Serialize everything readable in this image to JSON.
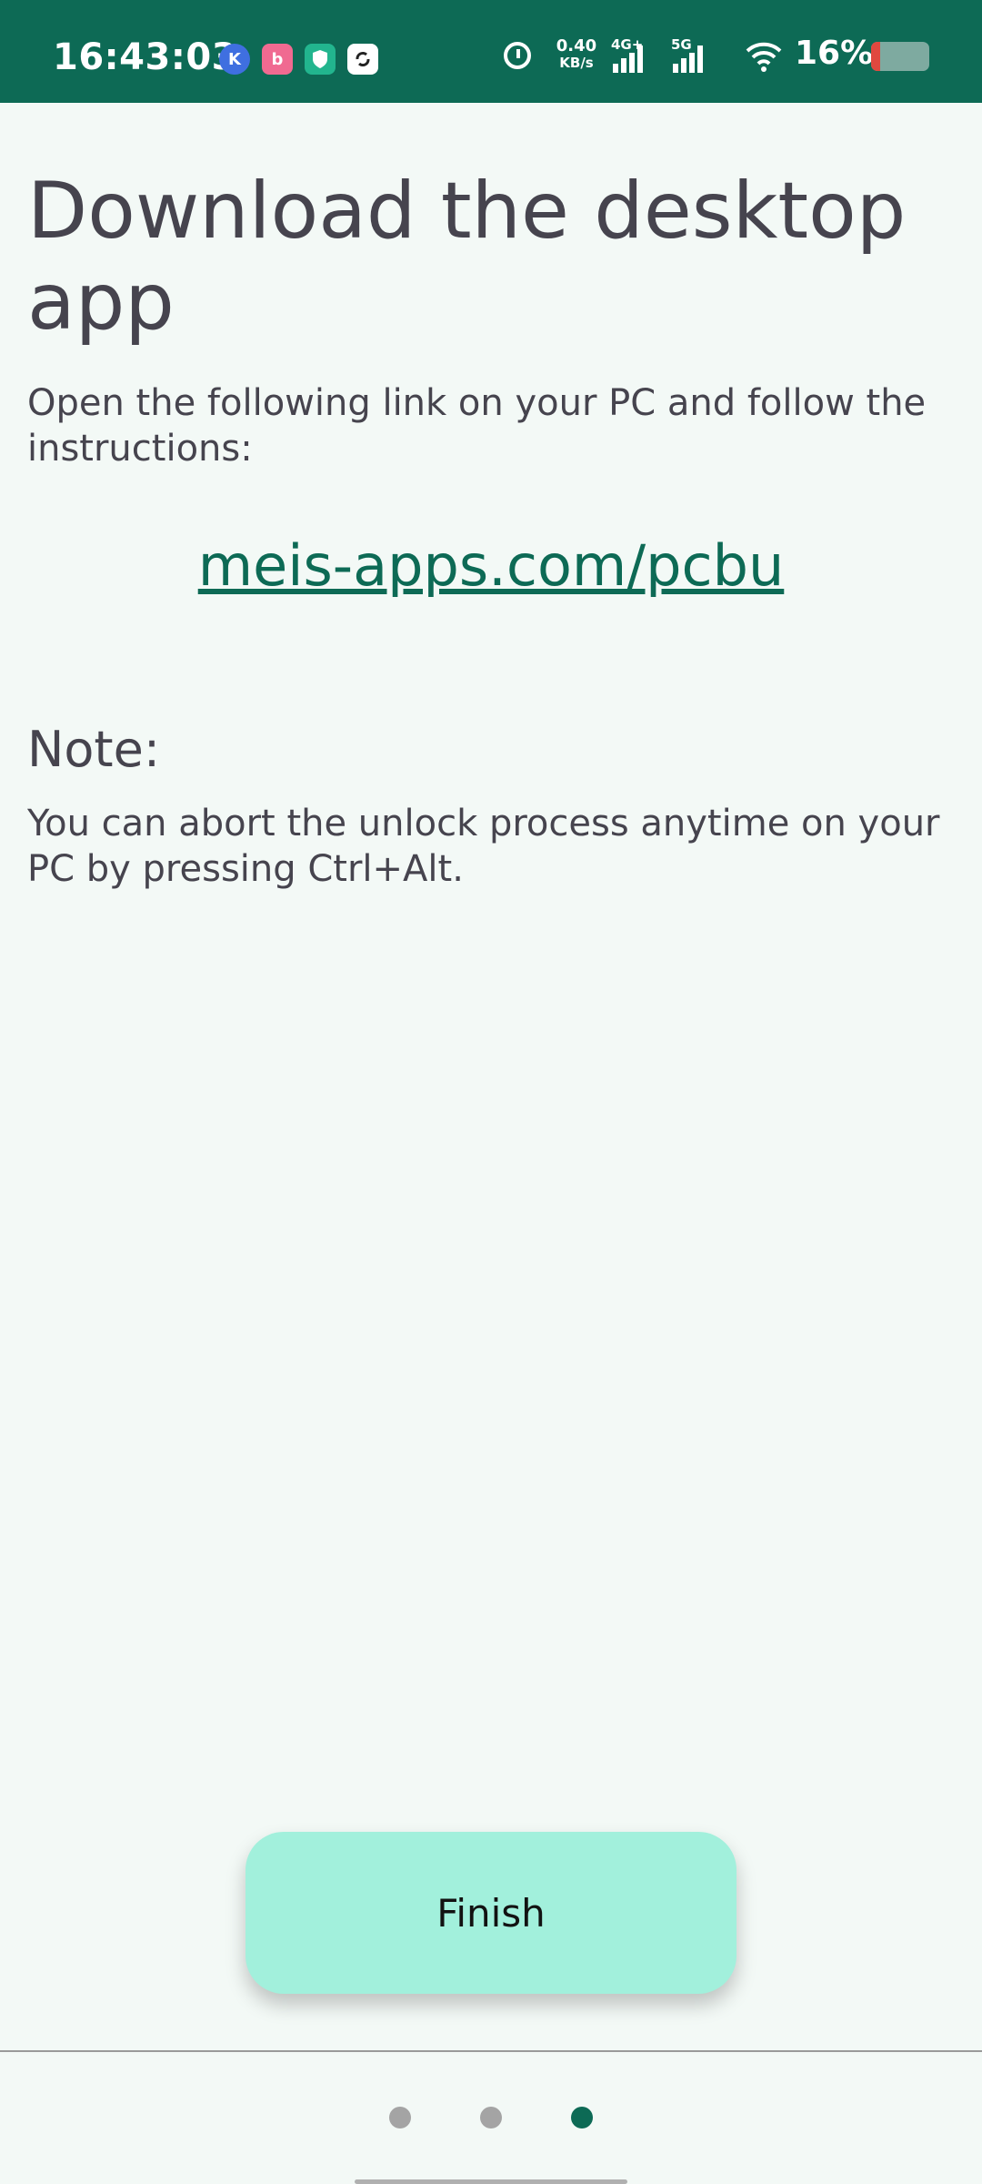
{
  "status_bar": {
    "time": "16:43:03",
    "net_speed_value": "0.40",
    "net_speed_unit": "KB/s",
    "signal_1_label": "4G+",
    "signal_2_label": "5G",
    "battery_percent": "16%",
    "battery_level": 0.16,
    "notification_icons": [
      "k-app-icon",
      "bilibili-icon",
      "shield-app-icon",
      "sync-app-icon"
    ]
  },
  "page": {
    "title": "Download the desktop app",
    "intro": "Open the following link on your PC and follow the instructions:",
    "link": "meis-apps.com/pcbu",
    "note_heading": "Note:",
    "note_body": "You can abort the unlock process anytime on your PC by pressing Ctrl+Alt."
  },
  "footer": {
    "finish_label": "Finish",
    "pages": 3,
    "active_page": 3
  },
  "colors": {
    "status_bar": "#0d6a55",
    "background": "#f3f9f6",
    "accent": "#0d6a55",
    "button": "#a2f0dc"
  }
}
